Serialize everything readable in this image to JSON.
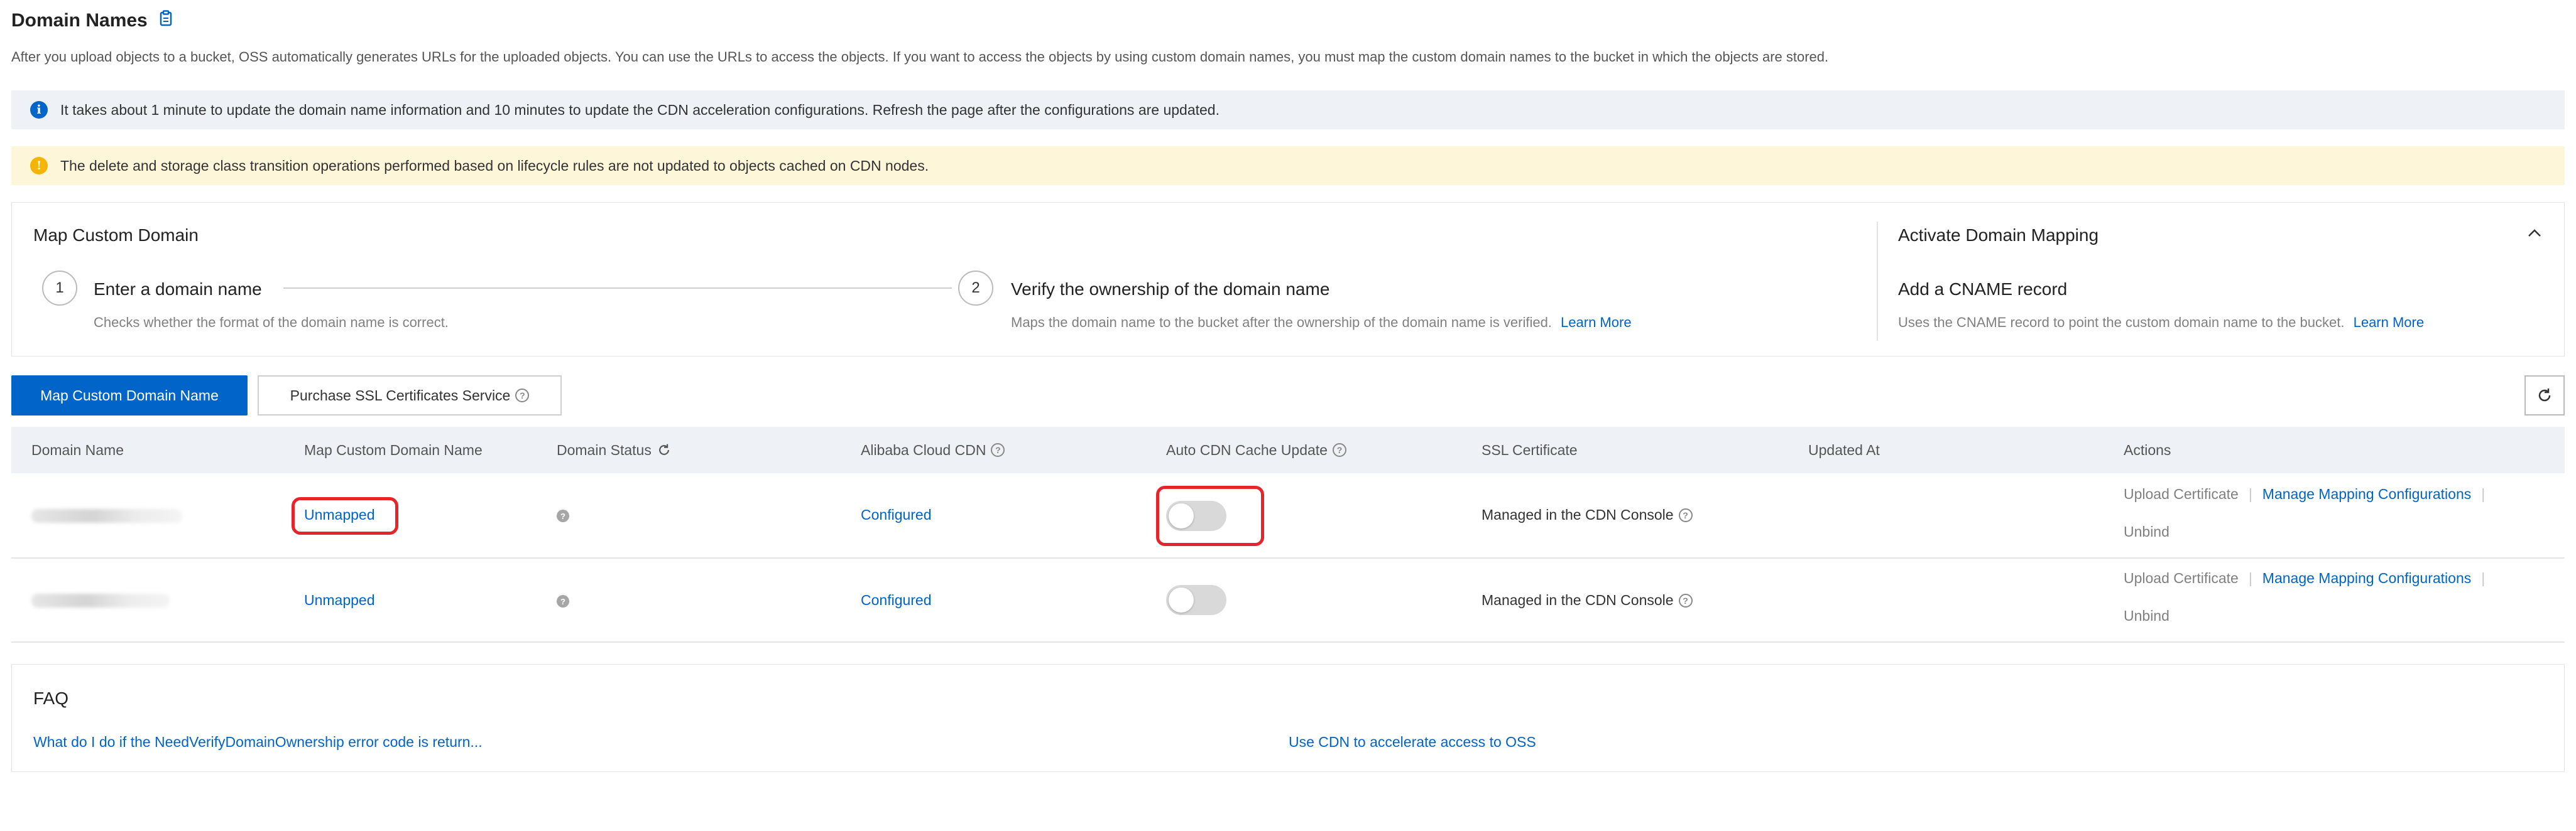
{
  "header": {
    "title": "Domain Names",
    "description": "After you upload objects to a bucket, OSS automatically generates URLs for the uploaded objects. You can use the URLs to access the objects. If you want to access the objects by using custom domain names, you must map the custom domain names to the bucket in which the objects are stored."
  },
  "notices": {
    "info": "It takes about 1 minute to update the domain name information and 10 minutes to update the CDN acceleration configurations. Refresh the page after the configurations are updated.",
    "warning": "The delete and storage class transition operations performed based on lifecycle rules are not updated to objects cached on CDN nodes."
  },
  "map_panel": {
    "title": "Map Custom Domain",
    "steps": [
      {
        "number": "1",
        "title": "Enter a domain name",
        "desc": "Checks whether the format of the domain name is correct."
      },
      {
        "number": "2",
        "title": "Verify the ownership of the domain name",
        "desc": "Maps the domain name to the bucket after the ownership of the domain name is verified.",
        "link": "Learn More"
      }
    ],
    "activate": {
      "title": "Activate Domain Mapping",
      "step_title": "Add a CNAME record",
      "desc": "Uses the CNAME record to point the custom domain name to the bucket.",
      "link": "Learn More"
    }
  },
  "toolbar": {
    "map_button": "Map Custom Domain Name",
    "ssl_button": "Purchase SSL Certificates Service"
  },
  "table": {
    "headers": {
      "domain_name": "Domain Name",
      "map_custom": "Map Custom Domain Name",
      "domain_status": "Domain Status",
      "cdn": "Alibaba Cloud CDN",
      "auto_cdn": "Auto CDN Cache Update",
      "ssl": "SSL Certificate",
      "updated_at": "Updated At",
      "actions": "Actions"
    },
    "rows": [
      {
        "map_status": "Unmapped",
        "cdn": "Configured",
        "auto_cdn_enabled": false,
        "ssl": "Managed in the CDN Console",
        "updated_at": "",
        "actions": {
          "upload": "Upload Certificate",
          "manage": "Manage Mapping Configurations",
          "unbind": "Unbind"
        }
      },
      {
        "map_status": "Unmapped",
        "cdn": "Configured",
        "auto_cdn_enabled": false,
        "ssl": "Managed in the CDN Console",
        "updated_at": "",
        "actions": {
          "upload": "Upload Certificate",
          "manage": "Manage Mapping Configurations",
          "unbind": "Unbind"
        }
      }
    ]
  },
  "faq": {
    "title": "FAQ",
    "links": [
      "What do I do if the NeedVerifyDomainOwnership error code is return...",
      "Use CDN to accelerate access to OSS"
    ]
  },
  "colors": {
    "primary": "#0064c8",
    "info_bg": "#eef1f6",
    "warning_bg": "#fef6d9",
    "warning_icon": "#f5b400",
    "info_icon": "#0064c8",
    "highlight": "#e5252a"
  },
  "icons": [
    "copy-icon",
    "info-icon",
    "warning-icon",
    "step-1-circle",
    "step-2-circle",
    "chevron-up-icon",
    "help-icon",
    "refresh-icon",
    "status-icon"
  ]
}
